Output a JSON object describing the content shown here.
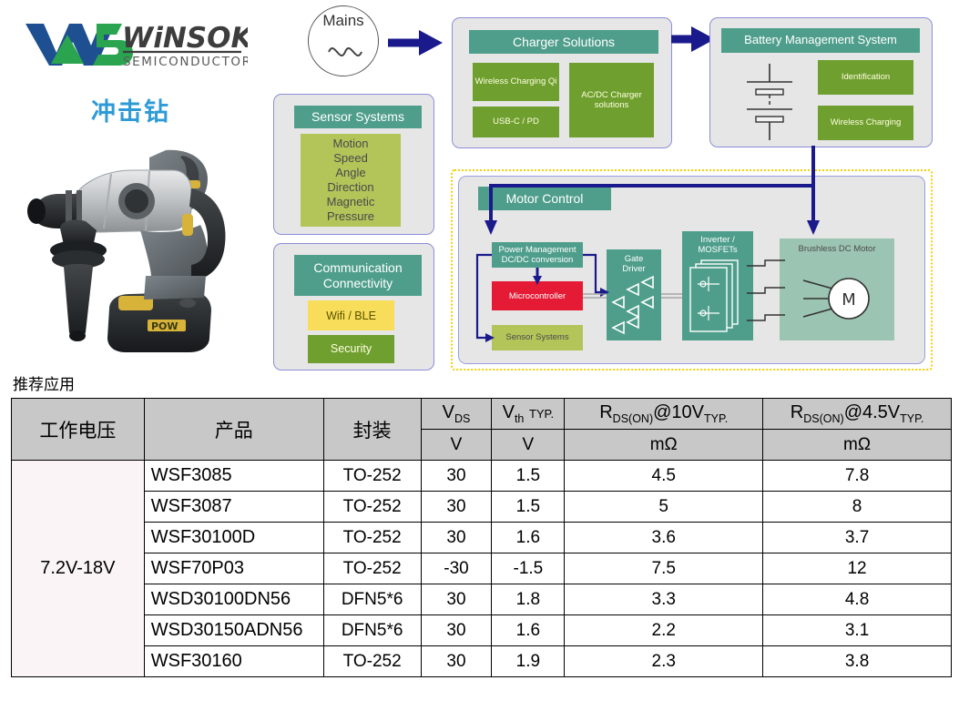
{
  "brand": {
    "name": "WiNSOK",
    "sub": "SEMICONDUCTOR"
  },
  "title_cn": "冲击钻",
  "photo_caption": "impact-hammer-drill",
  "recommend_label": "推荐应用",
  "diagram": {
    "mains": {
      "label": "Mains"
    },
    "charger": {
      "header": "Charger Solutions",
      "items": [
        "Wireless Charging Qi",
        "USB-C / PD",
        "AC/DC Charger solutions"
      ]
    },
    "bms": {
      "header": "Battery Management System",
      "items": [
        "Identification",
        "Wireless Charging"
      ]
    },
    "sensor": {
      "header": "Sensor Systems",
      "items": [
        "Motion",
        "Speed",
        "Angle",
        "Direction",
        "Magnetic",
        "Pressure"
      ]
    },
    "comm": {
      "header": "Communication Connectivity",
      "header_line1": "Communication",
      "header_line2": "Connectivity",
      "items": [
        "Wifi / BLE",
        "Security"
      ]
    },
    "motor": {
      "header": "Motor Control",
      "power_mgmt_line1": "Power Management",
      "power_mgmt_line2": "DC/DC conversion",
      "microcontroller": "Microcontroller",
      "sensor_systems": "Sensor Systems",
      "gate_driver_line1": "Gate",
      "gate_driver_line2": "Driver",
      "inverter_line1": "Inverter /",
      "inverter_line2": "MOSFETs",
      "bldc": "Brushless DC Motor",
      "motor_symbol": "M"
    },
    "colors": {
      "teal": "#4f9e8c",
      "green": "#6f9f2f",
      "olive": "#b3c459",
      "yellow": "#f7dd5a",
      "red": "#e51b36",
      "mint": "#9cc4b2",
      "arrow": "#1a1a8c",
      "panel_bg": "#e6e6e6",
      "panel_border": "#8b8ed8",
      "dotted": "#f5d000"
    }
  },
  "table": {
    "headers": {
      "voltage": "工作电压",
      "product": "产品",
      "package": "封装",
      "vds": "V",
      "vds_sub": "DS",
      "vth": "V",
      "vth_sub": "th",
      "vth_typ": "TYP.",
      "rds10_r": "R",
      "rds10_sub": "DS(ON)",
      "rds10_at": "@10V",
      "rds10_typ": "TYP.",
      "rds45_r": "R",
      "rds45_sub": "DS(ON)",
      "rds45_at": "@4.5V",
      "rds45_typ": "TYP."
    },
    "units": {
      "vds": "V",
      "vth": "V",
      "rds10": "mΩ",
      "rds45": "mΩ"
    },
    "voltage_range": "7.2V-18V",
    "rows": [
      {
        "product": "WSF3085",
        "package": "TO-252",
        "vds": "30",
        "vth": "1.5",
        "rds10": "4.5",
        "rds45": "7.8"
      },
      {
        "product": "WSF3087",
        "package": "TO-252",
        "vds": "30",
        "vth": "1.5",
        "rds10": "5",
        "rds45": "8"
      },
      {
        "product": "WSF30100D",
        "package": "TO-252",
        "vds": "30",
        "vth": "1.6",
        "rds10": "3.6",
        "rds45": "3.7"
      },
      {
        "product": "WSF70P03",
        "package": "TO-252",
        "vds": "-30",
        "vth": "-1.5",
        "rds10": "7.5",
        "rds45": "12"
      },
      {
        "product": "WSD30100DN56",
        "package": "DFN5*6",
        "vds": "30",
        "vth": "1.8",
        "rds10": "3.3",
        "rds45": "4.8"
      },
      {
        "product": "WSD30150ADN56",
        "package": "DFN5*6",
        "vds": "30",
        "vth": "1.6",
        "rds10": "2.2",
        "rds45": "3.1"
      },
      {
        "product": "WSF30160",
        "package": "TO-252",
        "vds": "30",
        "vth": "1.9",
        "rds10": "2.3",
        "rds45": "3.8"
      }
    ]
  }
}
